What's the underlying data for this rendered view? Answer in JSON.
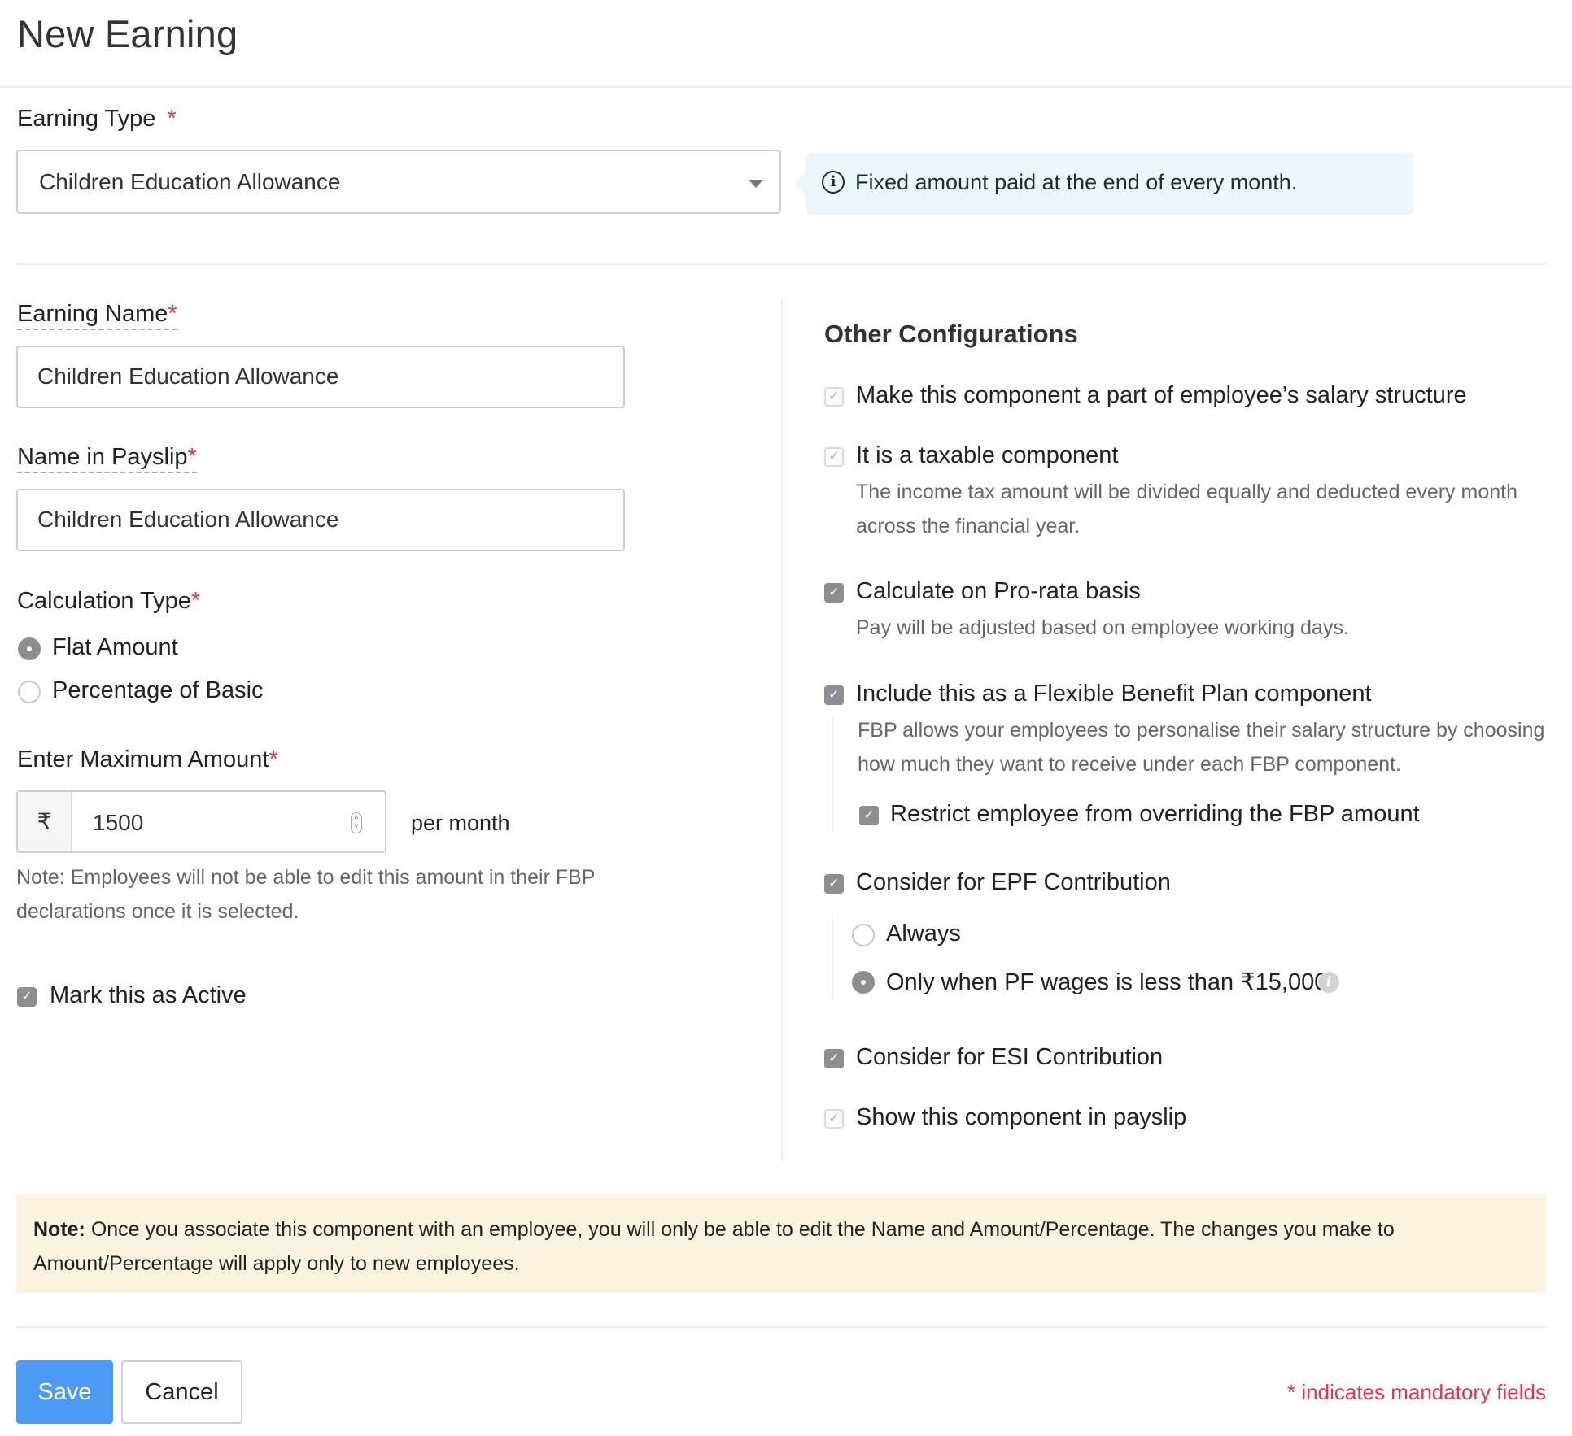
{
  "page": {
    "title": "New Earning"
  },
  "earning_type": {
    "label": "Earning Type",
    "required_mark": "*",
    "selected": "Children Education Allowance",
    "info_icon": "info-circle-icon",
    "info_text": "Fixed amount paid at the end of every month."
  },
  "earning_name": {
    "label": "Earning Name",
    "required_mark": "*",
    "value": "Children Education Allowance"
  },
  "name_in_payslip": {
    "label": "Name in Payslip",
    "required_mark": "*",
    "value": "Children Education Allowance"
  },
  "calculation_type": {
    "label": "Calculation Type",
    "required_mark": "*",
    "options": [
      {
        "label": "Flat Amount",
        "selected": true
      },
      {
        "label": "Percentage of Basic",
        "selected": false
      }
    ]
  },
  "max_amount": {
    "label": "Enter Maximum Amount",
    "required_mark": "*",
    "currency_symbol": "₹",
    "value": "1500",
    "suffix": "per month",
    "note": "Note: Employees will not be able to edit this amount in their FBP declarations once it is selected."
  },
  "mark_active": {
    "label": "Mark this as Active",
    "checked": true
  },
  "other_config": {
    "heading": "Other Configurations",
    "items": [
      {
        "label": "Make this component a part of employee’s salary structure",
        "checked": true,
        "disabled": true
      },
      {
        "label": "It is a taxable component",
        "checked": true,
        "disabled": true,
        "description": "The income tax amount will be divided equally and deducted every month across the financial year."
      },
      {
        "label": "Calculate on Pro-rata basis",
        "checked": true,
        "disabled": false,
        "description": "Pay will be adjusted based on employee working days."
      },
      {
        "label": "Include this as a Flexible Benefit Plan component",
        "checked": true,
        "disabled": false,
        "description": "FBP allows your employees to personalise their salary structure by choosing how much they want to receive under each FBP component.",
        "sub_checkbox": {
          "label": "Restrict employee from overriding the FBP amount",
          "checked": true
        }
      },
      {
        "label": "Consider for EPF Contribution",
        "checked": true,
        "disabled": false,
        "sub_options": [
          {
            "label": "Always",
            "selected": false
          },
          {
            "label": "Only when PF wages is less than ₹15,000",
            "selected": true
          }
        ]
      },
      {
        "label": "Consider for ESI Contribution",
        "checked": true,
        "disabled": false
      },
      {
        "label": "Show this component in payslip",
        "checked": true,
        "disabled": true
      }
    ]
  },
  "footer_note": {
    "prefix": "Note:",
    "text": " Once you associate this component with an employee, you will only be able to edit the Name and Amount/Percentage. The changes you make to Amount/Percentage will apply only to new employees."
  },
  "actions": {
    "save": "Save",
    "cancel": "Cancel",
    "mandatory_hint": "* indicates mandatory fields"
  },
  "colors": {
    "primary": "#4d9af5",
    "required": "#f0304a",
    "info_bg": "#edf5fd",
    "note_bg": "#fdf3e1",
    "checkbox": "#8d8d93"
  }
}
